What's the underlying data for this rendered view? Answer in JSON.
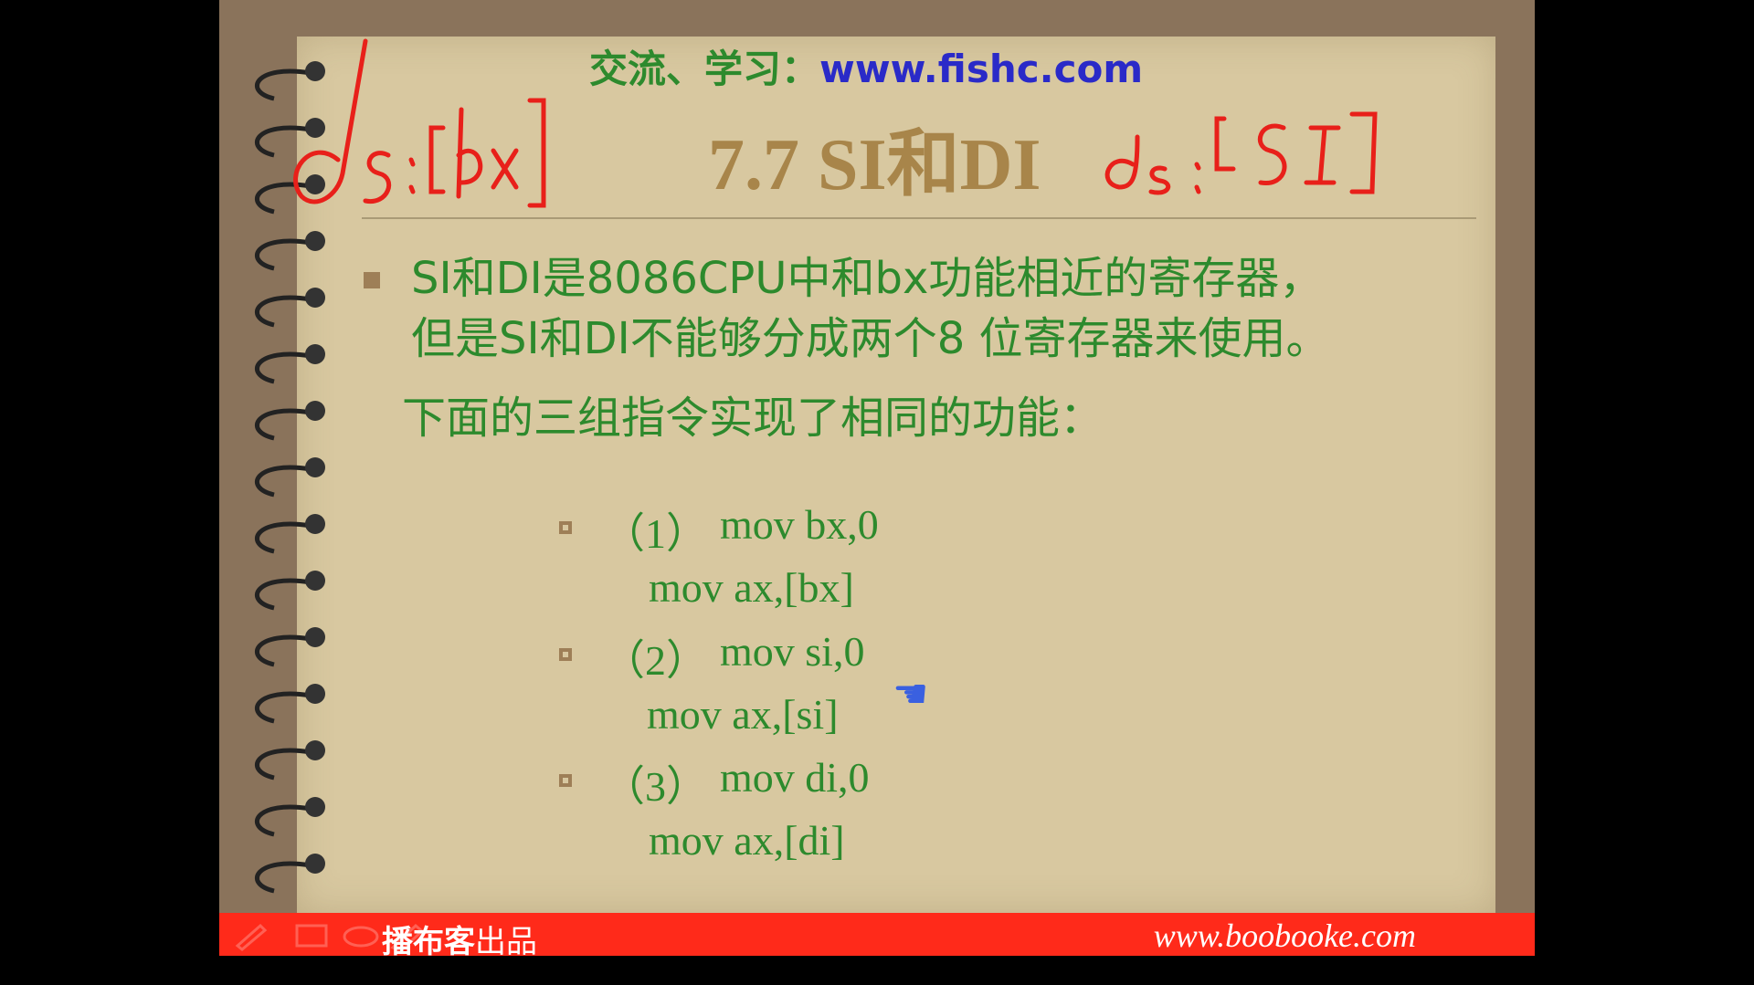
{
  "header": {
    "site_label": "交流、学习：",
    "site_url": "www.fishc.com"
  },
  "slide": {
    "title": "7.7 SI和DI",
    "annotations": {
      "left": "ds:[bx]",
      "right": "ds:[SI]"
    },
    "paragraph_line1": "SI和DI是8086CPU中和bx功能相近的寄存器，",
    "paragraph_line2": "但是SI和DI不能够分成两个8 位寄存器来使用。",
    "paragraph_intro": "下面的三组指令实现了相同的功能：",
    "groups": [
      {
        "num": "（1）",
        "line1": "mov bx,0",
        "line2": "mov ax,[bx]"
      },
      {
        "num": "（2）",
        "line1": "mov si,0",
        "line2": "mov ax,[si]"
      },
      {
        "num": "（3）",
        "line1": "mov di,0",
        "line2": "mov ax,[di]"
      }
    ]
  },
  "footer": {
    "brand": "播布客",
    "brand_suffix": "出品",
    "url": "www.boobooke.com"
  },
  "icons": {
    "cursor": "hand-pointer-icon",
    "toolbar": [
      "pen-icon",
      "screen-icon",
      "eraser-icon",
      "pencil-icon"
    ]
  },
  "colors": {
    "green_text": "#2d8a2d",
    "title_gold": "#a8854a",
    "footer_red": "#ff2a1a",
    "ink_red": "#e8201a",
    "url_blue": "#2a2ac8"
  }
}
